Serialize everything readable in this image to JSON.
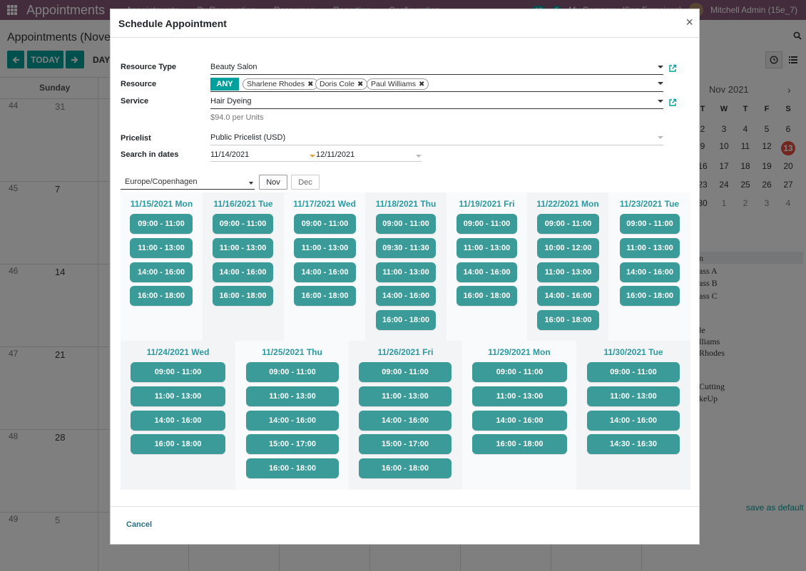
{
  "background": {
    "app_title": "Appointments",
    "menu_items": [
      "Appointments",
      "By Reservation",
      "Resources",
      "Reporting",
      "Configuration"
    ],
    "user_label": "Mitchell Admin (15e_7)",
    "notification_counts": [
      "18",
      "5"
    ],
    "company_label": "My Company (San Francisco)",
    "page_title": "Appointments (November 2021)",
    "today_label": "TODAY",
    "day_view_label": "DAY",
    "sunday_label": "Sunday",
    "week_numbers": [
      "44",
      "45",
      "46",
      "47",
      "48",
      "49"
    ],
    "sunday_dates": [
      "31",
      "7",
      "14",
      "21",
      "28",
      "5"
    ],
    "mini_month": "Nov 2021",
    "mini_weekdays": [
      "T",
      "W",
      "T",
      "F",
      "S"
    ],
    "mini_rows": [
      [
        "2",
        "3",
        "4",
        "5",
        "6"
      ],
      [
        "9",
        "10",
        "11",
        "12",
        "13"
      ],
      [
        "16",
        "17",
        "18",
        "19",
        "20"
      ],
      [
        "23",
        "24",
        "25",
        "26",
        "27"
      ],
      [
        "30",
        "1",
        "2",
        "3",
        "4"
      ]
    ],
    "filter_items": [
      "n",
      "ass A",
      "ass B",
      "ass C",
      "le",
      "lliams",
      "Rhodes",
      "Cutting",
      "keUp"
    ],
    "save_default": "save as default"
  },
  "modal": {
    "title": "Schedule Appointment",
    "close": "×",
    "fields": {
      "resource_type_label": "Resource Type",
      "resource_type_value": "Beauty Salon",
      "resource_label": "Resource",
      "any_label": "ANY",
      "resources": [
        "Sharlene Rhodes",
        "Doris Cole",
        "Paul Williams"
      ],
      "service_label": "Service",
      "service_value": "Hair Dyeing",
      "price_note": "$94.0 per Units",
      "pricelist_label": "Pricelist",
      "pricelist_value": "Public Pricelist (USD)",
      "search_dates_label": "Search in dates",
      "date_from": "11/14/2021",
      "date_to": "12/11/2021"
    },
    "timezone": "Europe/Copenhagen",
    "months": [
      "Nov",
      "Dec"
    ],
    "slots": [
      {
        "date": "11/15/2021 Mon",
        "times": [
          "09:00 - 11:00",
          "11:00 - 13:00",
          "14:00 - 16:00",
          "16:00 - 18:00"
        ]
      },
      {
        "date": "11/16/2021 Tue",
        "times": [
          "09:00 - 11:00",
          "11:00 - 13:00",
          "14:00 - 16:00",
          "16:00 - 18:00"
        ]
      },
      {
        "date": "11/17/2021 Wed",
        "times": [
          "09:00 - 11:00",
          "11:00 - 13:00",
          "14:00 - 16:00",
          "16:00 - 18:00"
        ]
      },
      {
        "date": "11/18/2021 Thu",
        "times": [
          "09:00 - 11:00",
          "09:30 - 11:30",
          "11:00 - 13:00",
          "14:00 - 16:00",
          "16:00 - 18:00"
        ]
      },
      {
        "date": "11/19/2021 Fri",
        "times": [
          "09:00 - 11:00",
          "11:00 - 13:00",
          "14:00 - 16:00",
          "16:00 - 18:00"
        ]
      },
      {
        "date": "11/22/2021 Mon",
        "times": [
          "09:00 - 11:00",
          "10:00 - 12:00",
          "11:00 - 13:00",
          "14:00 - 16:00",
          "16:00 - 18:00"
        ]
      },
      {
        "date": "11/23/2021 Tue",
        "times": [
          "09:00 - 11:00",
          "11:00 - 13:00",
          "14:00 - 16:00",
          "16:00 - 18:00"
        ]
      },
      {
        "date": "11/24/2021 Wed",
        "times": [
          "09:00 - 11:00",
          "11:00 - 13:00",
          "14:00 - 16:00",
          "16:00 - 18:00"
        ]
      },
      {
        "date": "11/25/2021 Thu",
        "times": [
          "09:00 - 11:00",
          "11:00 - 13:00",
          "14:00 - 16:00",
          "15:00 - 17:00",
          "16:00 - 18:00"
        ]
      },
      {
        "date": "11/26/2021 Fri",
        "times": [
          "09:00 - 11:00",
          "11:00 - 13:00",
          "14:00 - 16:00",
          "15:00 - 17:00",
          "16:00 - 18:00"
        ]
      },
      {
        "date": "11/29/2021 Mon",
        "times": [
          "09:00 - 11:00",
          "11:00 - 13:00",
          "14:00 - 16:00",
          "16:00 - 18:00"
        ]
      },
      {
        "date": "11/30/2021 Tue",
        "times": [
          "09:00 - 11:00",
          "11:00 - 13:00",
          "14:00 - 16:00",
          "14:30 - 16:30"
        ]
      }
    ],
    "cancel_label": "Cancel"
  },
  "colors": {
    "brand": "#875a7b",
    "accent": "#00a09d",
    "slot_button": "#3a9b99",
    "day_heading": "#2a9aa0",
    "today_marker": "#e74c3c"
  },
  "icons": {
    "apps": "apps-grid-icon",
    "close": "close-icon",
    "external_link": "external-link-icon",
    "tag_remove": "remove-tag-icon",
    "dropdown": "chevron-down-icon"
  }
}
